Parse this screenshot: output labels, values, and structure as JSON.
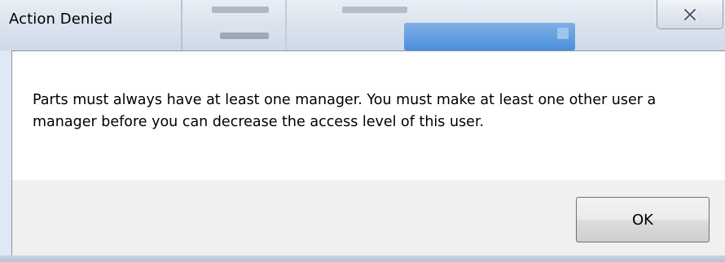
{
  "dialog": {
    "title": "Action Denied",
    "message": "Parts must always have at least one manager. You must make at least one other user a manager before you can decrease the access level of this user.",
    "ok_label": "OK",
    "close_icon": "close-icon"
  },
  "colors": {
    "content_background": "#ffffff",
    "footer_background": "#f0f0f0",
    "titlebar_background": "#dbe3ee"
  }
}
